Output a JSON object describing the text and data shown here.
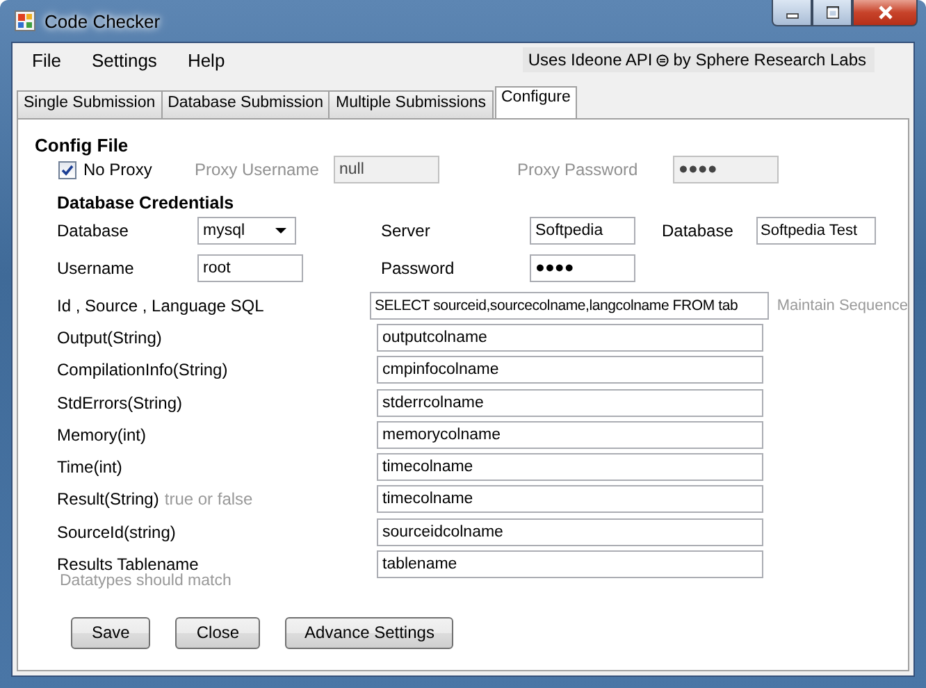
{
  "window": {
    "title": "Code Checker"
  },
  "menu": [
    {
      "label": "File"
    },
    {
      "label": "Settings"
    },
    {
      "label": "Help"
    }
  ],
  "credit": {
    "before": "Uses Ideone API",
    "after": "by Sphere Research Labs"
  },
  "tabs": [
    {
      "label": "Single Submission",
      "selected": false
    },
    {
      "label": "Database Submission",
      "selected": false
    },
    {
      "label": "Multiple Submissions",
      "selected": false
    },
    {
      "label": "Configure",
      "selected": true
    }
  ],
  "config_file": {
    "heading": "Config File",
    "no_proxy": {
      "label": "No Proxy",
      "checked": true
    },
    "proxy_fields": [
      {
        "label": "Proxy Username",
        "value": "null",
        "disabled": true
      },
      {
        "label": "Proxy Password",
        "value": "●●●●",
        "disabled": true
      }
    ]
  },
  "credentials": {
    "heading": "Database Credentials",
    "row1": [
      {
        "kind": "dropdown",
        "label": "Database",
        "value": "mysql"
      },
      {
        "kind": "text",
        "label": "Server",
        "value": "Softpedia"
      },
      {
        "kind": "text",
        "label": "Database",
        "value": "Softpedia Test"
      }
    ],
    "row2": [
      {
        "kind": "text",
        "label": "Username",
        "value": "root"
      },
      {
        "kind": "text",
        "label": "Password",
        "value": "●●●●"
      }
    ]
  },
  "fields": [
    {
      "label": "Id , Source , Language SQL",
      "value": "SELECT sourceid,sourcecolname,langcolname FROM tab",
      "hint": "Maintain Sequence"
    },
    {
      "label": "Output(String)",
      "value": "outputcolname"
    },
    {
      "label": "CompilationInfo(String)",
      "value": "cmpinfocolname"
    },
    {
      "label": "StdErrors(String)",
      "value": "stderrcolname"
    },
    {
      "label": "Memory(int)",
      "value": "memorycolname"
    },
    {
      "label": "Time(int)",
      "value": "timecolname"
    },
    {
      "label": "Result(String)",
      "note": "true or false",
      "value": "timecolname"
    },
    {
      "label": "SourceId(string)",
      "value": "sourceidcolname"
    },
    {
      "label": "Results Tablename",
      "value": "tablename"
    }
  ],
  "footnote": "Datatypes should match",
  "buttons": [
    "Save",
    "Close",
    "Advance Settings"
  ]
}
